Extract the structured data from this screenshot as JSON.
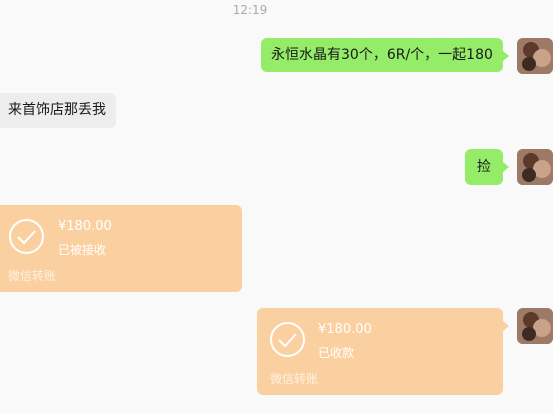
{
  "timestamp": "12:19",
  "messages": [
    {
      "sender": "me",
      "type": "text",
      "text": "永恒水晶有30个，6R/个，一起180"
    },
    {
      "sender": "other",
      "type": "text",
      "text": "来首饰店那丢我"
    },
    {
      "sender": "me",
      "type": "text",
      "text": "捡"
    },
    {
      "sender": "other",
      "type": "transfer",
      "amount": "¥180.00",
      "status": "已被接收",
      "label": "微信转账"
    },
    {
      "sender": "me",
      "type": "transfer",
      "amount": "¥180.00",
      "status": "已收款",
      "label": "微信转账"
    }
  ],
  "colors": {
    "my_bubble": "#95ec69",
    "other_bubble": "#ededed",
    "transfer_card": "#fbd0a0",
    "background": "#f9f9fa"
  }
}
